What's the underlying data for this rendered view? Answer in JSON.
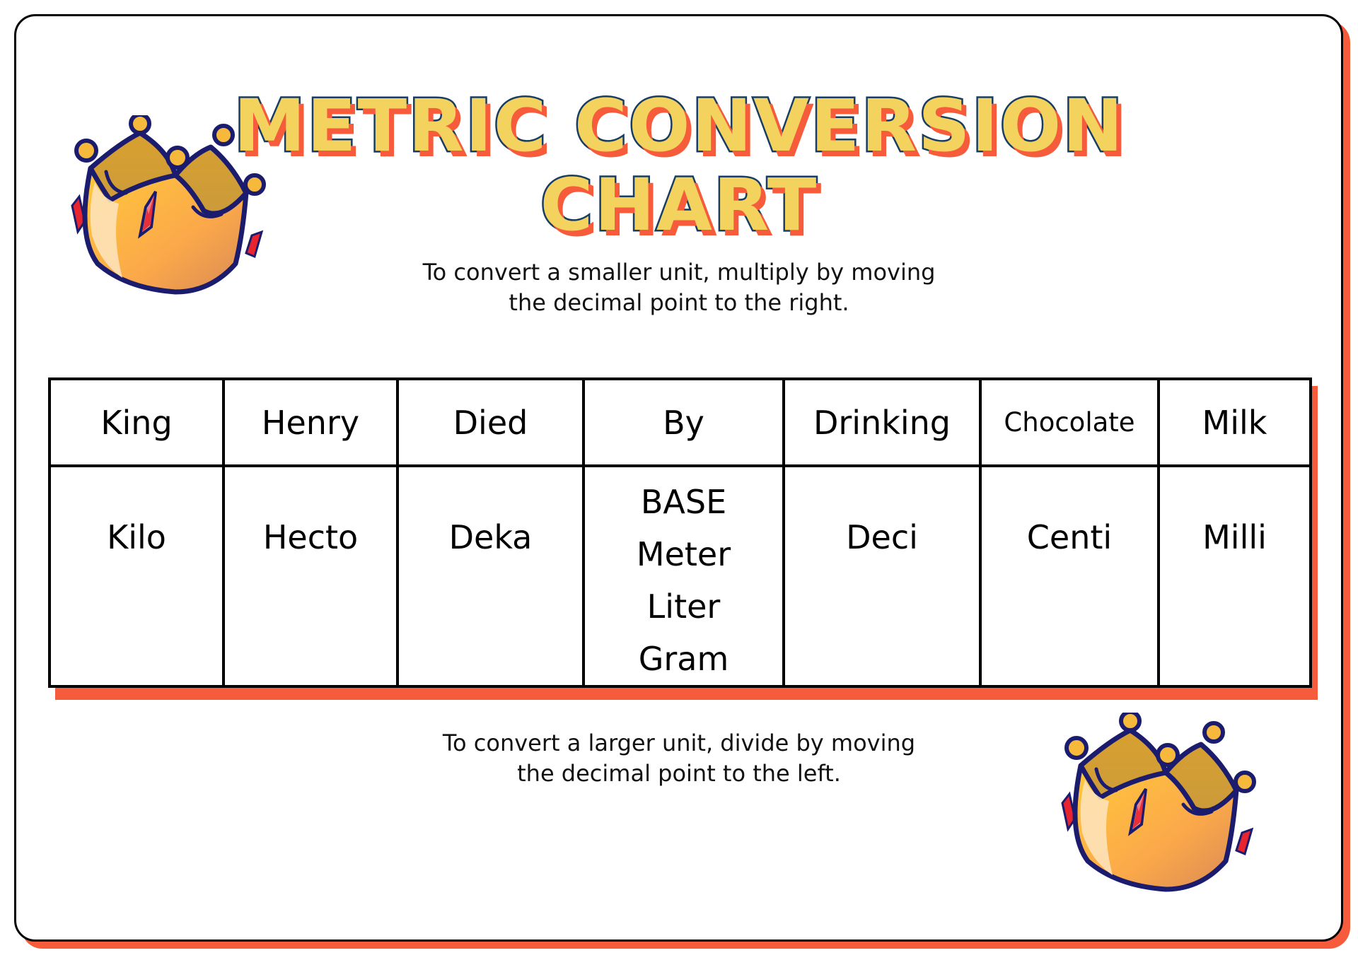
{
  "title": {
    "line1": "METRIC CONVERSION",
    "line2": "CHART"
  },
  "instructions": {
    "top_line1": "To convert a smaller unit, multiply by moving",
    "top_line2": "the decimal point to the right.",
    "bottom_line1": "To convert a larger unit, divide by moving",
    "bottom_line2": "the decimal point to the left."
  },
  "table": {
    "mnemonic": [
      "King",
      "Henry",
      "Died",
      "By",
      "Drinking",
      "Chocolate",
      "Milk"
    ],
    "prefixes": [
      "Kilo",
      "Hecto",
      "Deka",
      "",
      "Deci",
      "Centi",
      "Milli"
    ],
    "base": {
      "label": "BASE",
      "units": [
        "Meter",
        "Liter",
        "Gram"
      ]
    }
  },
  "decorations": {
    "top_left": "crown-icon",
    "bottom_right": "crown-icon"
  },
  "colors": {
    "title_fill": "#f3d25e",
    "title_outline": "#183d64",
    "accent_shadow": "#f65c3b",
    "border": "#000000"
  }
}
